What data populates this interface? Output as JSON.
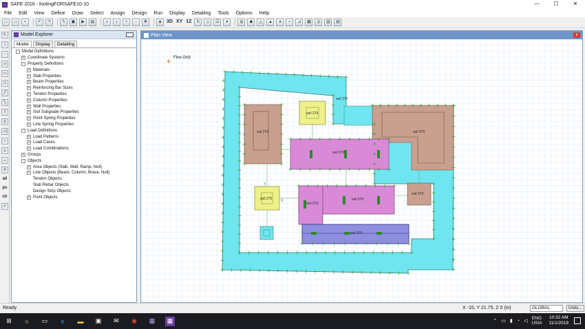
{
  "window": {
    "title": "SAFE 2016 - footingFORSAFE10-10",
    "minimize": "—",
    "maximize": "☐",
    "close": "✕"
  },
  "menu": [
    "File",
    "Edit",
    "View",
    "Define",
    "Draw",
    "Select",
    "Assign",
    "Design",
    "Run",
    "Display",
    "Detailing",
    "Tools",
    "Options",
    "Help"
  ],
  "toolbar": {
    "label_3d": "3D",
    "label_xy": "XY",
    "label_1z": "1Z"
  },
  "left_tools": {
    "all": "all",
    "ps": "ps",
    "clr": "clr"
  },
  "explorer": {
    "title": "Model Explorer",
    "tabs": [
      "Model",
      "Display",
      "Detailing"
    ],
    "tree": [
      {
        "level": 0,
        "label": "Model Definitions",
        "exp": "-"
      },
      {
        "level": 1,
        "label": "Coordinate Systems",
        "exp": "+"
      },
      {
        "level": 1,
        "label": "Property Definitions",
        "exp": "-"
      },
      {
        "level": 2,
        "label": "Materials",
        "exp": "+"
      },
      {
        "level": 2,
        "label": "Slab Properties",
        "exp": "+"
      },
      {
        "level": 2,
        "label": "Beam Properties",
        "exp": "+"
      },
      {
        "level": 2,
        "label": "Reinforcing Bar Sizes",
        "exp": "+"
      },
      {
        "level": 2,
        "label": "Tendon Properties",
        "exp": "+"
      },
      {
        "level": 2,
        "label": "Column Properties",
        "exp": "+"
      },
      {
        "level": 2,
        "label": "Wall Properties",
        "exp": "+"
      },
      {
        "level": 2,
        "label": "Soil Subgrade Properties",
        "exp": "+"
      },
      {
        "level": 2,
        "label": "Point Spring Properties",
        "exp": "+"
      },
      {
        "level": 2,
        "label": "Line Spring Properties",
        "exp": "+"
      },
      {
        "level": 1,
        "label": "Load Definitions",
        "exp": "-"
      },
      {
        "level": 2,
        "label": "Load Patterns",
        "exp": "+"
      },
      {
        "level": 2,
        "label": "Load Cases",
        "exp": "+"
      },
      {
        "level": 2,
        "label": "Load Combinations",
        "exp": "+"
      },
      {
        "level": 1,
        "label": "Groups",
        "exp": "+"
      },
      {
        "level": 1,
        "label": "Objects",
        "exp": "-"
      },
      {
        "level": 2,
        "label": "Area Objects (Slab, Wall, Ramp, Null)",
        "exp": "+"
      },
      {
        "level": 2,
        "label": "Line Objects (Beam, Column, Brace, Null)",
        "exp": "+"
      },
      {
        "level": 2,
        "label": "Tendon Objects",
        "exp": ""
      },
      {
        "level": 2,
        "label": "Slab Rebar Objects",
        "exp": ""
      },
      {
        "level": 2,
        "label": "Design Strip Objects",
        "exp": ""
      },
      {
        "level": 2,
        "label": "Point Objects",
        "exp": "+"
      }
    ]
  },
  "plan_view": {
    "title": "Plan View",
    "close": "x",
    "grid_label": "Fine Grid",
    "soil_labels": {
      "top_right_ring": "soil 270",
      "top_small": "soil 270",
      "left_block": "soil 270",
      "center_top": "soil 270",
      "right_block": "soil 270",
      "left_small": "soil 270",
      "center_small": "soil 270",
      "center_main": "soil 270",
      "right_small": "soil 270",
      "bottom_beam": "soil 270"
    },
    "axis_y": "Y",
    "axis_x": "X",
    "colors": {
      "ring": "#6fe6ef",
      "pink": "#d98ad6",
      "tan": "#c9a08e",
      "yellow": "#eef08a",
      "blue": "#8f8fe0"
    }
  },
  "status": {
    "ready": "Ready",
    "coords": "X -15, Y 21.75, Z 0  (in)",
    "coord_system": "GLOBAL",
    "units": "Units..."
  },
  "taskbar": {
    "lang_top": "ENG",
    "lang_bottom": "USIA",
    "time": "10:32 AM",
    "date": "11/1/2018"
  }
}
